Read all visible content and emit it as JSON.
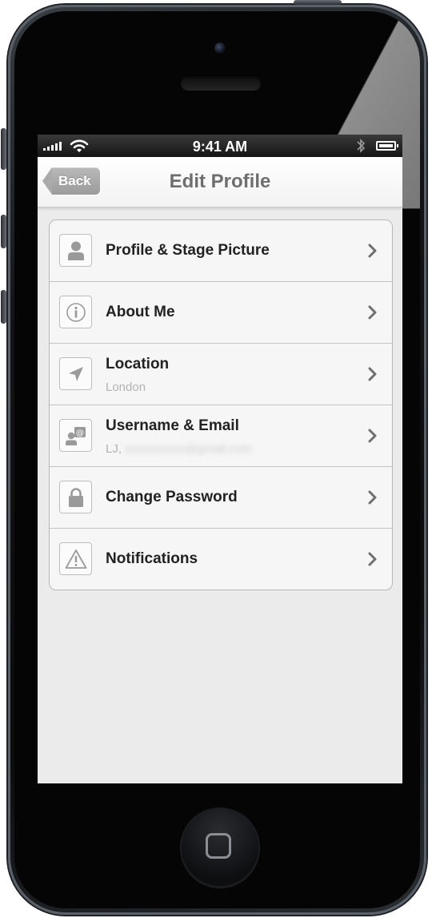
{
  "status_bar": {
    "time": "9:41 AM"
  },
  "nav": {
    "back_label": "Back",
    "title": "Edit Profile"
  },
  "rows": [
    {
      "icon": "person-icon",
      "title": "Profile & Stage Picture",
      "subtitle": ""
    },
    {
      "icon": "info-icon",
      "title": "About Me",
      "subtitle": ""
    },
    {
      "icon": "location-arrow-icon",
      "title": "Location",
      "subtitle": "London"
    },
    {
      "icon": "user-email-icon",
      "title": "Username & Email",
      "subtitle": "LJ,"
    },
    {
      "icon": "lock-icon",
      "title": "Change Password",
      "subtitle": ""
    },
    {
      "icon": "warning-icon",
      "title": "Notifications",
      "subtitle": ""
    }
  ],
  "colors": {
    "nav_title": "#6e6e6e",
    "back_button": "#a8a8a8",
    "screen_bg": "#ebebeb",
    "icon_gray": "#9a9a9a"
  }
}
